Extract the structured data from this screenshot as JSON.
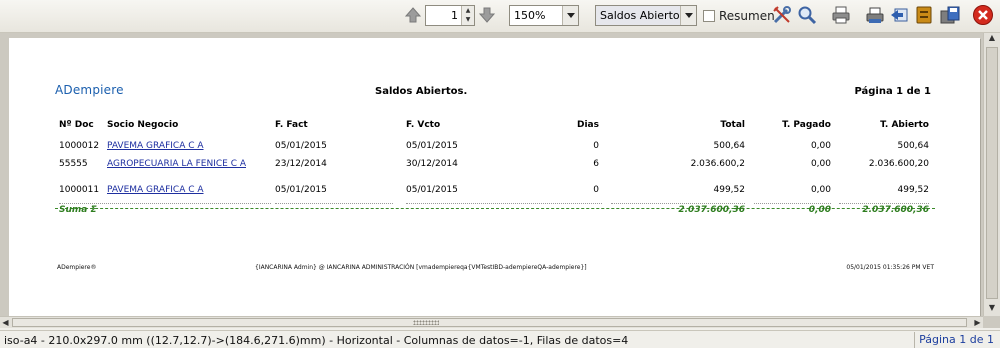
{
  "toolbar": {
    "page_number": "1",
    "zoom": "150%",
    "view": "Saldos Abiertos.",
    "resumen_label": "Resumen",
    "icons": [
      "arrow-up-icon",
      "arrow-down-icon",
      "tools-icon",
      "magnifier-icon",
      "printer-icon",
      "print-preview-icon",
      "export-icon",
      "archive-icon",
      "save-icon",
      "close-icon"
    ]
  },
  "report": {
    "logo": "ADempiere",
    "title": "Saldos Abiertos.",
    "page": "Página 1 de 1",
    "columns": [
      "Nº Doc",
      "Socio Negocio",
      "F. Fact",
      "F. Vcto",
      "Dias",
      "Total",
      "T. Pagado",
      "T. Abierto"
    ],
    "rows": [
      {
        "doc": "1000012",
        "socio": "PAVEMA GRAFICA C A",
        "ffact": "05/01/2015",
        "fvcto": "05/01/2015",
        "dias": "0",
        "total": "500,64",
        "pagado": "0,00",
        "abierto": "500,64"
      },
      {
        "doc": "55555",
        "socio": "AGROPECUARIA LA FENICE  C A",
        "ffact": "23/12/2014",
        "fvcto": "30/12/2014",
        "dias": "6",
        "total": "2.036.600,2",
        "pagado": "0,00",
        "abierto": "2.036.600,20"
      },
      {
        "doc": "1000011",
        "socio": "PAVEMA GRAFICA C A",
        "ffact": "05/01/2015",
        "fvcto": "05/01/2015",
        "dias": "0",
        "total": "499,52",
        "pagado": "0,00",
        "abierto": "499,52"
      }
    ],
    "sum": {
      "label": "Suma Σ",
      "total": "2.037.600,36",
      "pagado": "0,00",
      "abierto": "2.037.600,36"
    },
    "footer": {
      "left": "ADempiere®",
      "center": "{IANCARINA Admin} @ IANCARINA ADMINISTRACIÓN [vmadempiereqa{VMTestIBD-adempiereQA-adempiere}]",
      "right": "05/01/2015 01:35:26 PM VET"
    }
  },
  "status": {
    "text": "iso-a4 - 210.0x297.0 mm ((12.7,12.7)->(184.6,271.6)mm) - Horizontal - Columnas de datos=-1, Filas de datos=4",
    "page": "Página 1 de 1"
  }
}
